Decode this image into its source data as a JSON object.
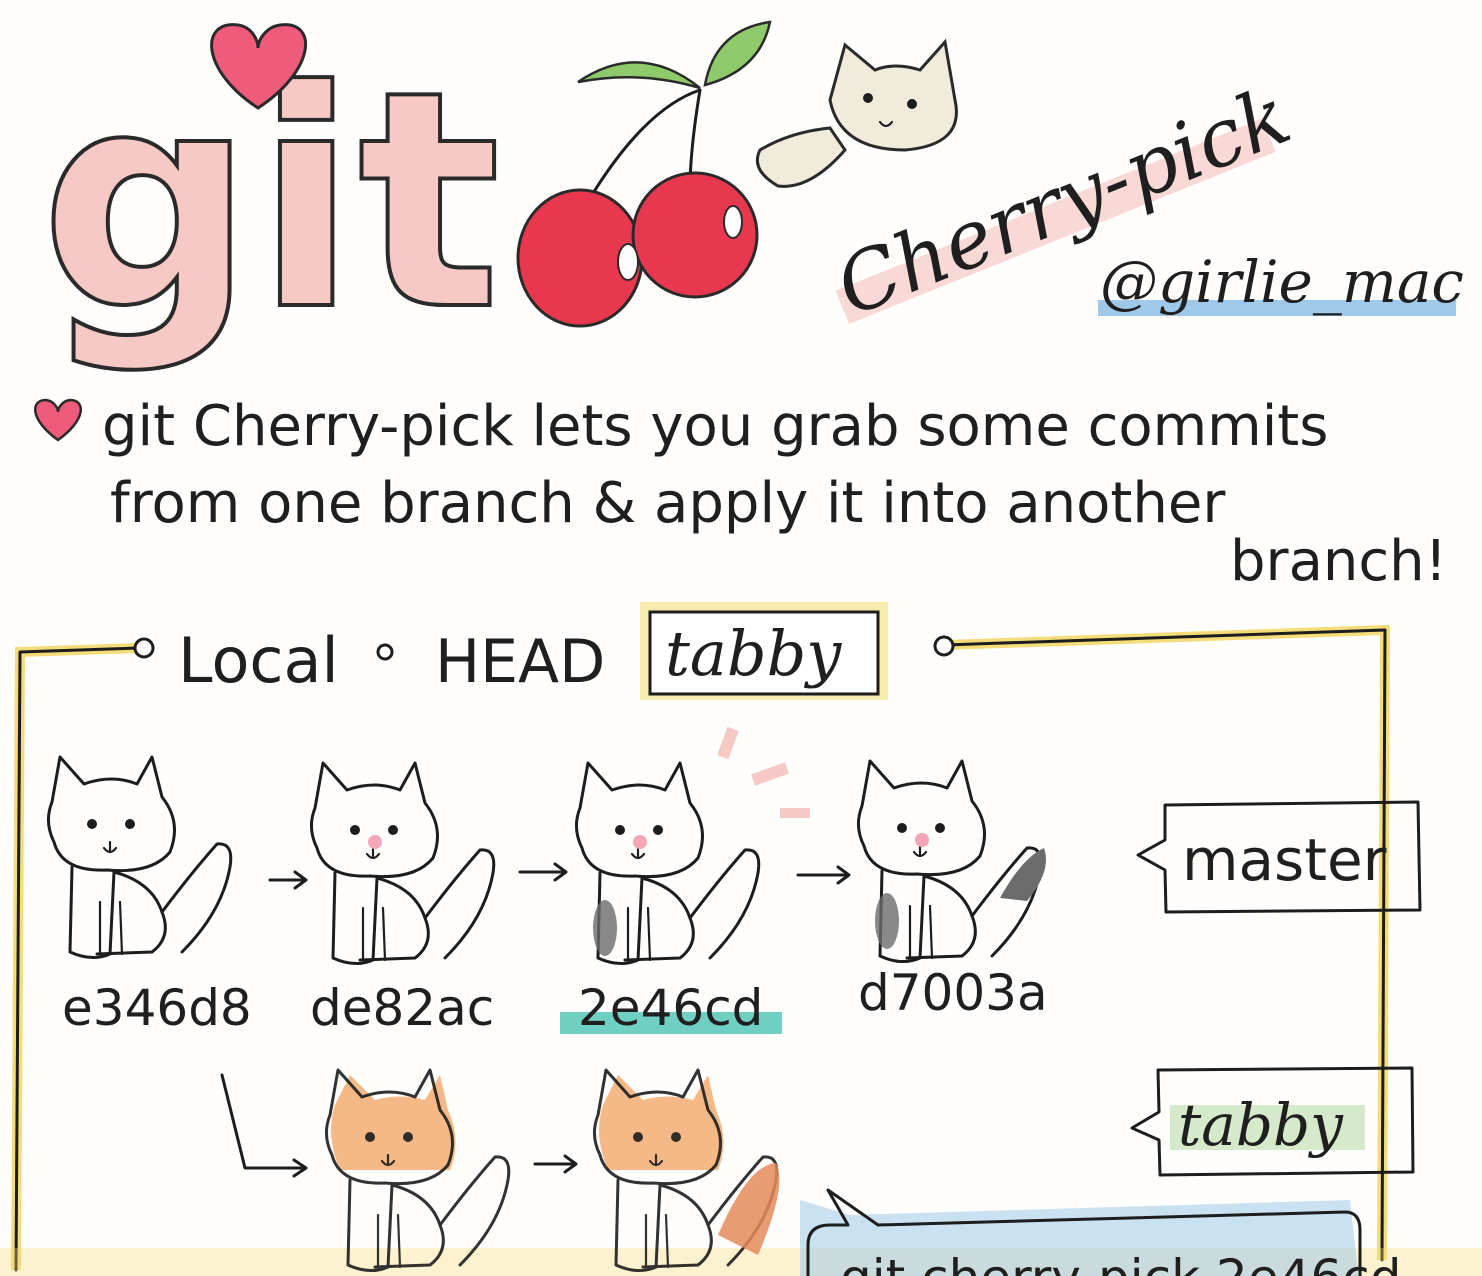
{
  "title": {
    "word_git": "git",
    "word_cherry_pick": "Cherry-pick",
    "author": "@girlie_mac"
  },
  "description": {
    "line1": "git Cherry-pick lets you grab some commits",
    "line2": "from one branch & apply it into another",
    "line3": "branch!"
  },
  "local_header": {
    "local_label": "Local",
    "head_label": "HEAD",
    "head_branch": "tabby"
  },
  "commits": [
    {
      "hash": "e346d8",
      "highlighted": false
    },
    {
      "hash": "de82ac",
      "highlighted": false
    },
    {
      "hash": "2e46cd",
      "highlighted": true
    },
    {
      "hash": "d7003a",
      "highlighted": false
    }
  ],
  "branches": {
    "master_label": "master",
    "tabby_label": "tabby"
  },
  "speech_bubble_text": "git cherry-pick 2e46cd",
  "colors": {
    "git_pink": "#f6c9c4",
    "heart_pink": "#ef5b7a",
    "cherry_red": "#e8384f",
    "leaf_green": "#8fca6a",
    "box_yellow": "#f5dc7a",
    "highlight_teal": "#6fcfc2",
    "underline_blue": "#9fc9ea",
    "cat_orange": "#f2a86a",
    "cat_cream": "#f1ebdb",
    "cat_gray": "#6c6c6c"
  },
  "icons": [
    "heart-icon",
    "cherries-icon",
    "cat-icon",
    "arrow-icon"
  ]
}
